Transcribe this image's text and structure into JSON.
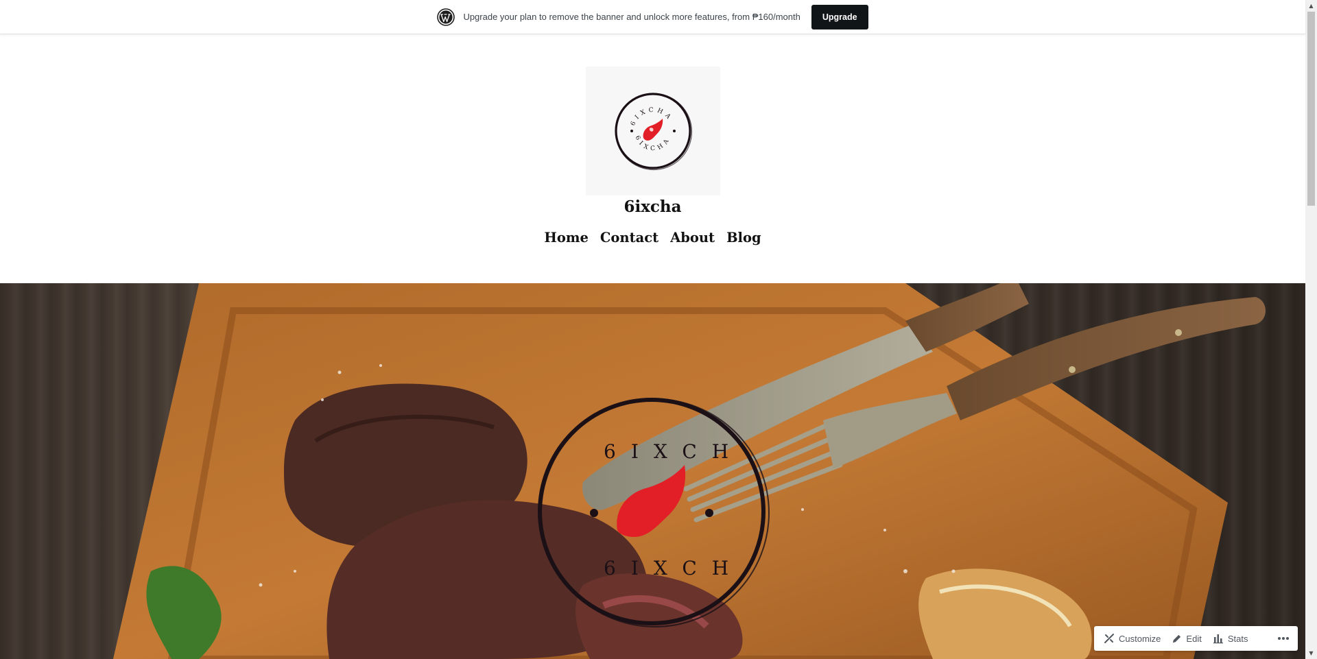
{
  "banner": {
    "logo_icon": "wordpress-logo-icon",
    "message": "Upgrade your plan to remove the banner and unlock more features, from ₱160/month",
    "upgrade_label": "Upgrade"
  },
  "site": {
    "title": "6ixcha",
    "logo_text_top": "6IXCHA",
    "logo_text_bottom": "6IXCHA",
    "brand_color": "#e21f26"
  },
  "nav": {
    "items": [
      {
        "label": "Home"
      },
      {
        "label": "Contact"
      },
      {
        "label": "About"
      },
      {
        "label": "Blog"
      }
    ]
  },
  "hero": {
    "image": "steak-on-cutting-board-with-knife-and-fork",
    "overlay_logo_text_top": "6IXCH",
    "overlay_logo_text_bottom": "6IXCH"
  },
  "admin_bar": {
    "customize_label": "Customize",
    "edit_label": "Edit",
    "stats_label": "Stats",
    "more_icon": "ellipsis-icon"
  },
  "scrollbar": {
    "up_glyph": "▲",
    "down_glyph": "▼"
  }
}
